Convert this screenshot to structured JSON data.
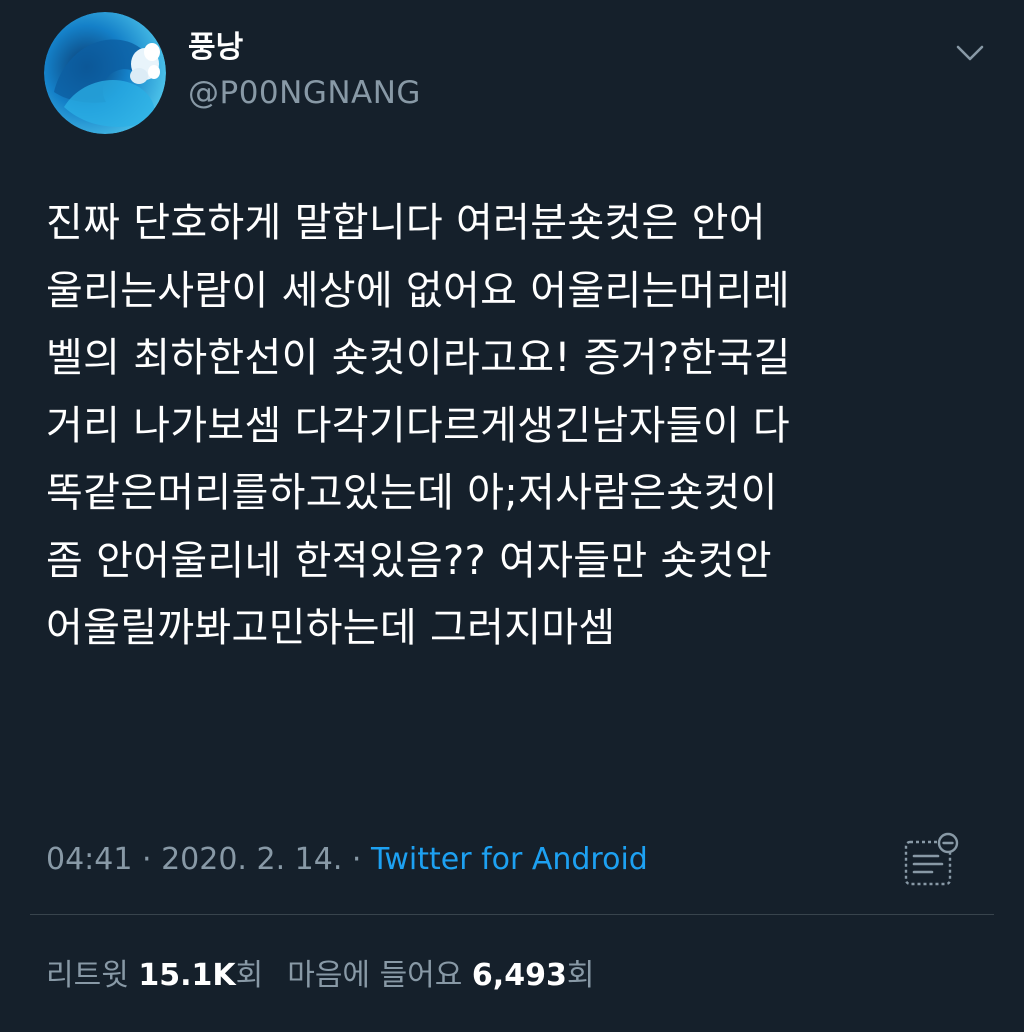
{
  "author": {
    "display_name": "풍낭",
    "handle": "@P00NGNANG",
    "avatar_icon": "wave-avatar-icon"
  },
  "tweet": {
    "text": "진짜 단호하게 말합니다 여러분숏컷은 안어\n울리는사람이 세상에 없어요 어울리는머리레\n벨의 최하한선이 숏컷이라고요! 증거?한국길\n거리 나가보셈 다각기다르게생긴남자들이 다\n똑같은머리를하고있는데 아;저사람은숏컷이\n좀 안어울리네 한적있음?? 여자들만 숏컷안\n어울릴까봐고민하는데 그러지마셈",
    "time": "04:41",
    "separator": " · ",
    "date": "2020. 2. 14.",
    "source": "Twitter for Android"
  },
  "stats": {
    "retweet_label": "리트윗",
    "retweet_count": "15.1K",
    "retweet_unit": "회",
    "like_label": "마음에 들어요",
    "like_count": "6,493",
    "like_unit": "회"
  },
  "colors": {
    "background": "#15202b",
    "text": "#ffffff",
    "secondary_text": "#8899a6",
    "link": "#1da1f2",
    "divider": "#38444d"
  },
  "icons": {
    "caret": "chevron-down-icon",
    "analytics": "analytics-icon"
  }
}
